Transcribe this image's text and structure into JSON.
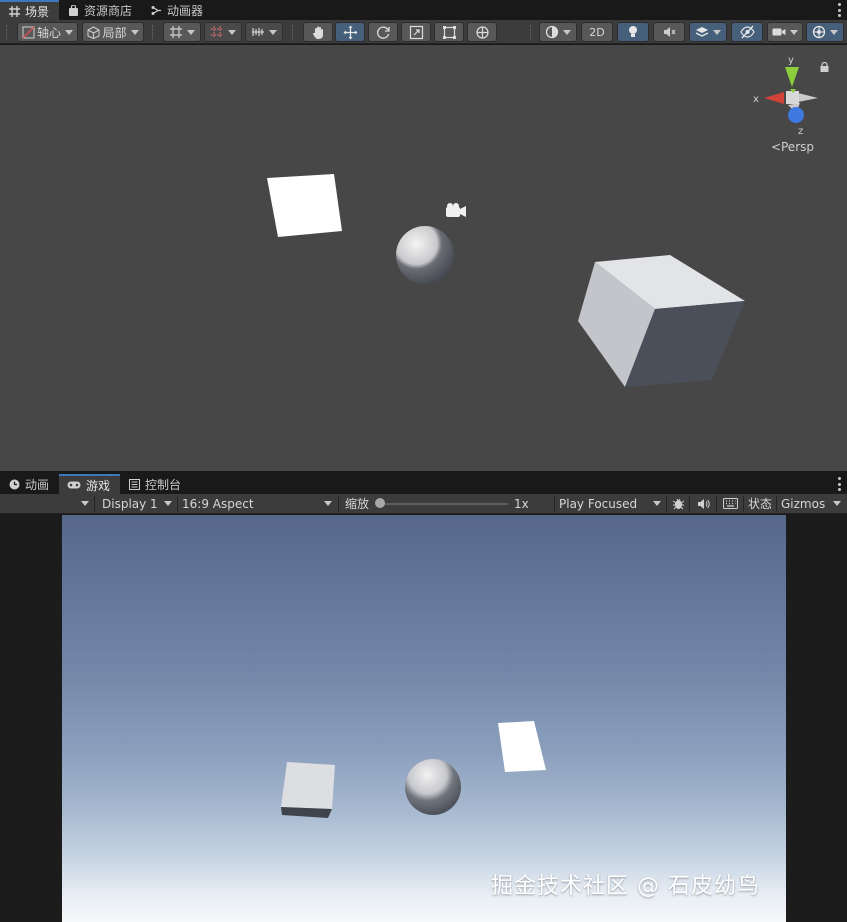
{
  "scene_tabs": [
    {
      "label": "场景",
      "icon": "grid-icon",
      "active": true
    },
    {
      "label": "资源商店",
      "icon": "bag-icon",
      "active": false
    },
    {
      "label": "动画器",
      "icon": "animator-icon",
      "active": false
    }
  ],
  "scene_toolbar": {
    "pivot_label": "轴心",
    "space_label": "局部",
    "mode_2d_label": "2D",
    "tools": [
      "hand-tool-icon",
      "move-tool-icon",
      "rotate-tool-icon",
      "scale-tool-icon",
      "rect-tool-icon",
      "transform-tool-icon"
    ]
  },
  "scene_view": {
    "projection_label": "Persp",
    "axis_labels": {
      "x": "x",
      "y": "y",
      "z": "z"
    }
  },
  "game_tabs": [
    {
      "label": "动画",
      "icon": "clock-icon",
      "active": false
    },
    {
      "label": "游戏",
      "icon": "gamepad-icon",
      "active": true
    },
    {
      "label": "控制台",
      "icon": "console-icon",
      "active": false
    }
  ],
  "game_toolbar": {
    "display_label": "Display 1",
    "aspect_label": "16:9 Aspect",
    "scale_label": "缩放",
    "scale_value": "1x",
    "play_mode_label": "Play Focused",
    "stats_label": "状态",
    "gizmos_label": "Gizmos"
  },
  "watermark": "掘金技术社区 @ 石皮幼鸟",
  "colors": {
    "accent_blue": "#3a79bb",
    "toolbar_bg": "#3c3c3c",
    "scene_bg": "#474747",
    "active_button": "#46607c"
  }
}
